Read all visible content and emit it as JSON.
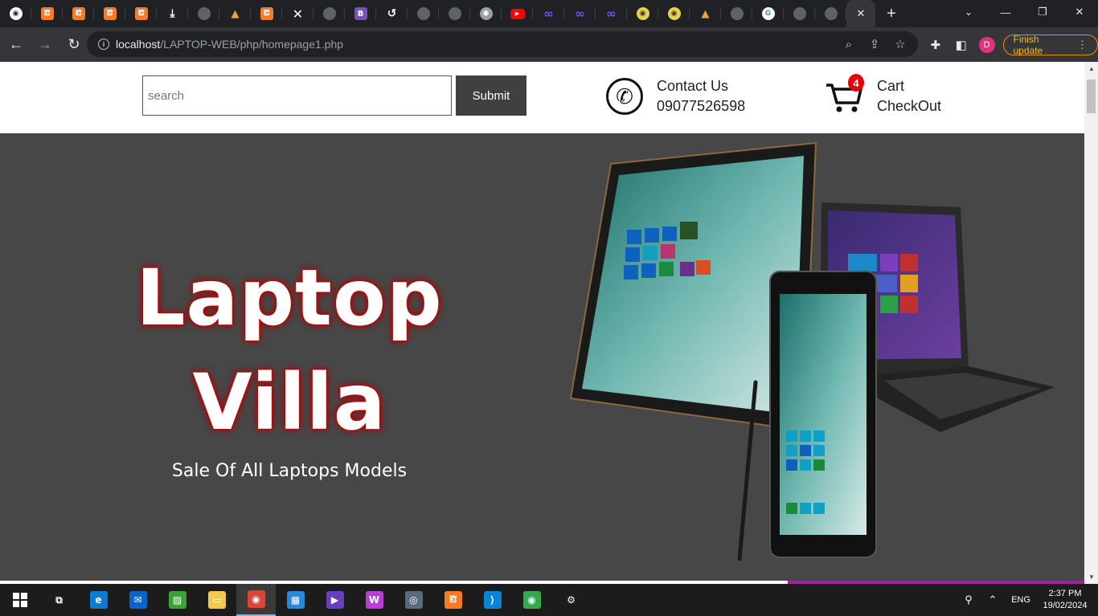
{
  "browser": {
    "tabs": [
      {
        "icon": "chrome-icon",
        "glyph": "◉",
        "kind": "chrome"
      },
      {
        "icon": "xampp-icon",
        "glyph": "ఔ",
        "kind": "xampp"
      },
      {
        "icon": "xampp-icon",
        "glyph": "ఔ",
        "kind": "xampp"
      },
      {
        "icon": "xampp-icon",
        "glyph": "ఔ",
        "kind": "xampp"
      },
      {
        "icon": "xampp-icon",
        "glyph": "ఔ",
        "kind": "xampp"
      },
      {
        "icon": "download-icon",
        "glyph": "⤓",
        "kind": "dl"
      },
      {
        "icon": "globe-icon",
        "glyph": "",
        "kind": "globe"
      },
      {
        "icon": "triangle-logo-icon",
        "glyph": "▲",
        "kind": "tri"
      },
      {
        "icon": "xampp-icon",
        "glyph": "ఔ",
        "kind": "xampp"
      },
      {
        "icon": "x-logo-icon",
        "glyph": "✕",
        "kind": "x"
      },
      {
        "icon": "globe-icon",
        "glyph": "",
        "kind": "globe"
      },
      {
        "icon": "bootstrap-icon",
        "glyph": "B",
        "kind": "b"
      },
      {
        "icon": "history-icon",
        "glyph": "↺",
        "kind": "hist"
      },
      {
        "icon": "globe-icon",
        "glyph": "",
        "kind": "globe"
      },
      {
        "icon": "globe-icon",
        "glyph": "",
        "kind": "globe"
      },
      {
        "icon": "openai-icon",
        "glyph": "✺",
        "kind": "gray"
      },
      {
        "icon": "youtube-icon",
        "glyph": "▶",
        "kind": "yt"
      },
      {
        "icon": "infinity-icon",
        "glyph": "∞",
        "kind": "inf"
      },
      {
        "icon": "infinity-icon",
        "glyph": "∞",
        "kind": "inf"
      },
      {
        "icon": "infinity-icon",
        "glyph": "∞",
        "kind": "inf"
      },
      {
        "icon": "owl-icon",
        "glyph": "◉",
        "kind": "owl"
      },
      {
        "icon": "owl-icon",
        "glyph": "◉",
        "kind": "owl"
      },
      {
        "icon": "triangle-logo-icon",
        "glyph": "▲",
        "kind": "tri"
      },
      {
        "icon": "globe-icon",
        "glyph": "",
        "kind": "globe"
      },
      {
        "icon": "google-icon",
        "glyph": "G",
        "kind": "gg"
      },
      {
        "icon": "globe-icon",
        "glyph": "",
        "kind": "globe"
      },
      {
        "icon": "globe-icon",
        "glyph": "",
        "kind": "globe"
      }
    ],
    "url_host": "localhost",
    "url_path": "/LAPTOP-WEB/php/homepage1.php",
    "profile_initial": "D",
    "finish_update_label": "Finish update"
  },
  "page": {
    "search": {
      "placeholder": "search",
      "value": ""
    },
    "submit_label": "Submit",
    "contact": {
      "title": "Contact Us",
      "phone": "09077526598"
    },
    "cart": {
      "count": "4",
      "label": "Cart",
      "checkout": "CheckOut"
    },
    "hero": {
      "title_line1": "Laptop",
      "title_line2": "Villa",
      "subtitle": "Sale Of All Laptops Models"
    }
  },
  "taskbar": {
    "apps": [
      {
        "name": "task-view-icon",
        "glyph": "⧉",
        "bg": "transparent"
      },
      {
        "name": "edge-icon",
        "glyph": "e",
        "bg": "#0c7bd6"
      },
      {
        "name": "mail-icon",
        "glyph": "✉",
        "bg": "#0a64c2"
      },
      {
        "name": "green-app-icon",
        "glyph": "▨",
        "bg": "#3aa335"
      },
      {
        "name": "file-explorer-icon",
        "glyph": "▭",
        "bg": "#f2c94c"
      },
      {
        "name": "chrome-icon",
        "glyph": "◉",
        "bg": "#db4437",
        "active": true
      },
      {
        "name": "store-icon",
        "glyph": "▦",
        "bg": "#2b88d8"
      },
      {
        "name": "video-editor-icon",
        "glyph": "▶",
        "bg": "#6a3fbf"
      },
      {
        "name": "wps-icon",
        "glyph": "W",
        "bg": "#b53fd0"
      },
      {
        "name": "camera-icon",
        "glyph": "◎",
        "bg": "#5a6b7d"
      },
      {
        "name": "xampp-icon",
        "glyph": "ఔ",
        "bg": "#fb7a24"
      },
      {
        "name": "vscode-icon",
        "glyph": "⟩",
        "bg": "#0a84d6"
      },
      {
        "name": "chrome-profile-icon",
        "glyph": "◉",
        "bg": "#34a853"
      },
      {
        "name": "settings-icon",
        "glyph": "⚙",
        "bg": "transparent"
      }
    ],
    "lang": "ENG",
    "time": "2:37 PM",
    "date": "19/02/2024"
  },
  "colors": {
    "hero_bg": "#474747",
    "submit_bg": "#404040",
    "badge": "#e60000",
    "title_glow": "#cc0000"
  }
}
